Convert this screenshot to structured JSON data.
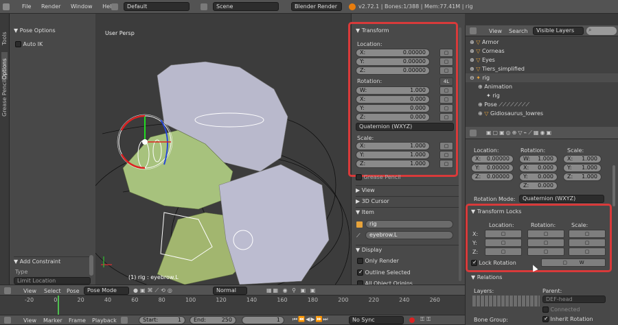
{
  "topbar": {
    "menus": [
      "File",
      "Render",
      "Window",
      "Help"
    ],
    "layout": "Default",
    "scene": "Scene",
    "engine": "Blender Render",
    "version": "v2.72.1 | Bones:1/388 | Mem:77.41M | rig"
  },
  "tools_tabs": [
    "Tools",
    "Options",
    "Grease Pencil"
  ],
  "left_panel": {
    "pose_options": "Pose Options",
    "auto_ik": "Auto IK",
    "add_constraint": "Add Constraint",
    "type_label": "Type",
    "type_value": "Limit Location"
  },
  "viewport": {
    "title": "User Persp",
    "status": "(1) rig : eyebrow.L"
  },
  "transform": {
    "title": "Transform",
    "location_label": "Location:",
    "location": [
      {
        "axis": "X:",
        "value": "0.00000"
      },
      {
        "axis": "Y:",
        "value": "0.00000"
      },
      {
        "axis": "Z:",
        "value": "0.00000"
      }
    ],
    "rotation_label": "Rotation:",
    "rotation_badge": "4L",
    "rotation": [
      {
        "axis": "W:",
        "value": "1.000"
      },
      {
        "axis": "X:",
        "value": "0.000"
      },
      {
        "axis": "Y:",
        "value": "0.000"
      },
      {
        "axis": "Z:",
        "value": "0.000"
      }
    ],
    "mode": "Quaternion (WXYZ)",
    "scale_label": "Scale:",
    "scale": [
      {
        "axis": "X:",
        "value": "1.000"
      },
      {
        "axis": "Y:",
        "value": "1.000"
      },
      {
        "axis": "Z:",
        "value": "1.000"
      }
    ]
  },
  "npanels": {
    "grease": "Grease Pencil",
    "view": "View",
    "cursor": "3D Cursor",
    "item": "Item",
    "item_obj": "rig",
    "item_bone": "eyebrow.L",
    "display": "Display",
    "only_render": "Only Render",
    "outline": "Outline Selected",
    "all_origins": "All Object Origins"
  },
  "outliner": {
    "view": "View",
    "search": "Search",
    "filter": "Visible Layers",
    "items": [
      {
        "name": "Armor",
        "indent": 0
      },
      {
        "name": "Corneas",
        "indent": 0
      },
      {
        "name": "Eyes",
        "indent": 0
      },
      {
        "name": "Tiers_simplified",
        "indent": 0
      },
      {
        "name": "rig",
        "indent": 0
      },
      {
        "name": "Animation",
        "indent": 1
      },
      {
        "name": "rig",
        "indent": 2
      },
      {
        "name": "Pose",
        "indent": 1
      },
      {
        "name": "Gidiosaurus_lowres",
        "indent": 1
      }
    ]
  },
  "props": {
    "location": "Location:",
    "rotation": "Rotation:",
    "scale": "Scale:",
    "loc": [
      {
        "a": "X:",
        "v": "0.00000"
      },
      {
        "a": "Y:",
        "v": "0.00000"
      },
      {
        "a": "Z:",
        "v": "0.00000"
      }
    ],
    "rot": [
      {
        "a": "W:",
        "v": "1.000"
      },
      {
        "a": "X:",
        "v": "0.000"
      },
      {
        "a": "Y:",
        "v": "0.000"
      },
      {
        "a": "Z:",
        "v": "0.000"
      }
    ],
    "scl": [
      {
        "a": "X:",
        "v": "1.000"
      },
      {
        "a": "Y:",
        "v": "1.000"
      },
      {
        "a": "Z:",
        "v": "1.000"
      }
    ],
    "rotation_mode_label": "Rotation Mode:",
    "rotation_mode": "Quaternion (WXYZ)"
  },
  "locks": {
    "title": "Transform Locks",
    "location": "Location:",
    "rotation": "Rotation:",
    "scale": "Scale:",
    "axes": [
      "X:",
      "Y:",
      "Z:"
    ],
    "lock_rotation": "Lock Rotation",
    "w": "W"
  },
  "relations": {
    "title": "Relations",
    "layers": "Layers:",
    "parent": "Parent:",
    "parent_value": "DEF-head",
    "connected": "Connected",
    "bone_group": "Bone Group:",
    "inherit": "Inherit Rotation"
  },
  "viewport_header": {
    "view": "View",
    "select": "Select",
    "pose": "Pose",
    "mode": "Pose Mode",
    "shading": "Normal"
  },
  "timeline": {
    "ticks": [
      "-20",
      "0",
      "20",
      "40",
      "60",
      "80",
      "100",
      "120",
      "140",
      "160",
      "180",
      "200",
      "220",
      "240",
      "260"
    ],
    "view": "View",
    "marker": "Marker",
    "frame": "Frame",
    "playback": "Playback",
    "start_label": "Start:",
    "start": "1",
    "end_label": "End:",
    "end": "250",
    "current": "1",
    "sync": "No Sync"
  }
}
